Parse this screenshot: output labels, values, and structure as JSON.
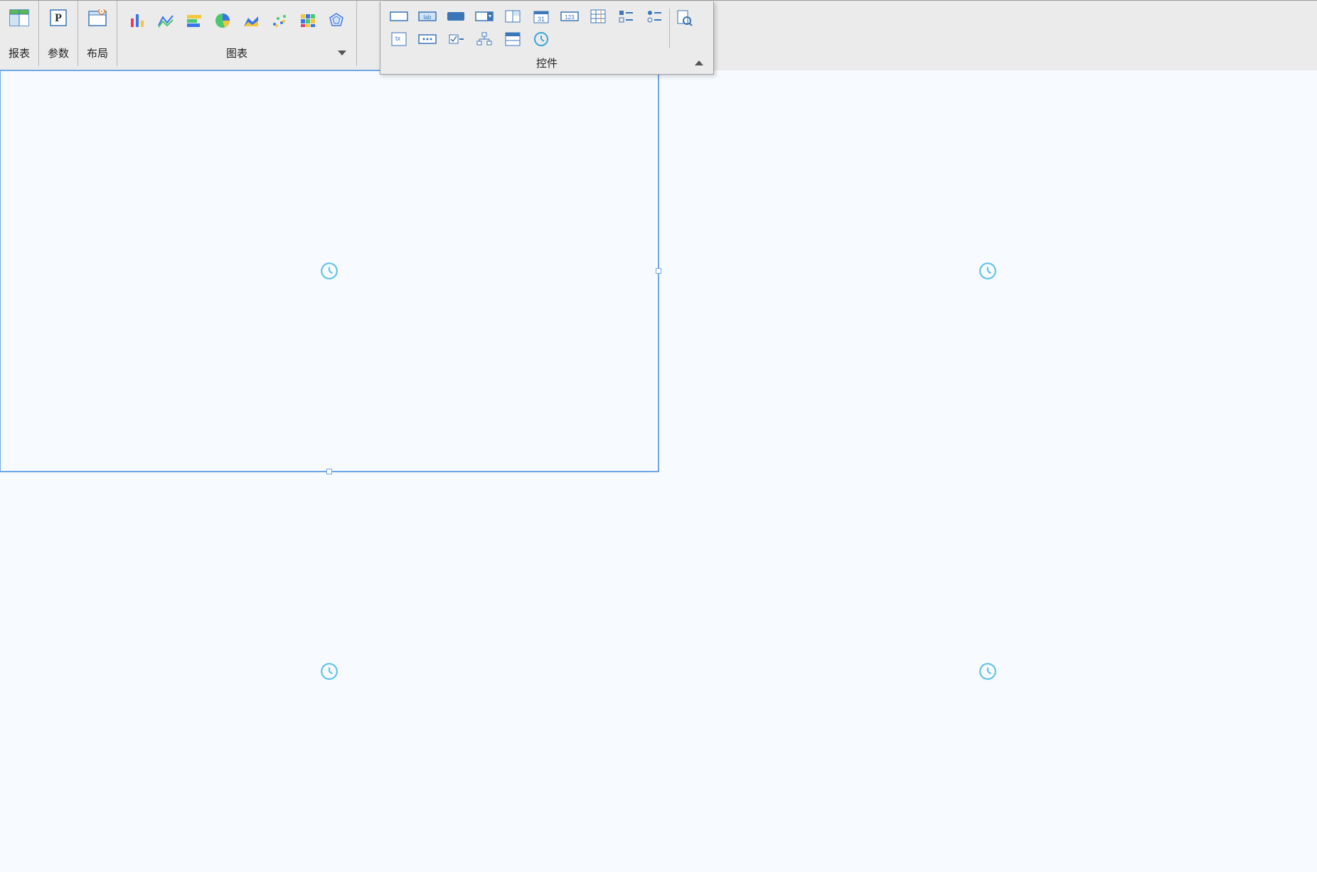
{
  "toolbar": {
    "report_label": "报表",
    "params_label": "参数",
    "layout_label": "布局",
    "chart_label": "图表",
    "controls_label": "控件",
    "chart_icons": [
      "bar-chart-icon",
      "line-chart-icon",
      "stacked-bar-icon",
      "pie-chart-icon",
      "area-chart-icon",
      "scatter-chart-icon",
      "heatmap-chart-icon",
      "radar-chart-icon"
    ],
    "control_icons_row1": [
      "textbox-control-icon",
      "label-control-icon",
      "button-control-icon",
      "combobox-control-icon",
      "datetime-control-icon",
      "calendar-control-icon",
      "number-control-icon",
      "table-control-icon",
      "checkbox-group-icon",
      "radio-group-icon"
    ],
    "control_icons_row2": [
      "textarea-control-icon",
      "password-control-icon",
      "checkbox-control-icon",
      "tree-control-icon",
      "list-control-icon",
      "clock-control-icon"
    ],
    "preview_icon": "preview-icon"
  },
  "canvas": {
    "cells": [
      {
        "placeholder": "clock",
        "selected": true
      },
      {
        "placeholder": "clock",
        "selected": false
      },
      {
        "placeholder": "clock",
        "selected": false
      },
      {
        "placeholder": "clock",
        "selected": false
      }
    ]
  }
}
